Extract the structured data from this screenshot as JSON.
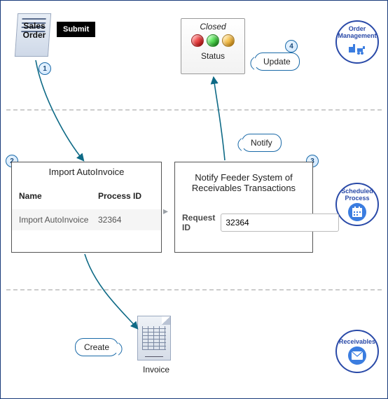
{
  "lanes": {
    "order_management": "Order Management",
    "scheduled_process": "Scheduled Process",
    "receivables": "Receivables"
  },
  "sales_order": {
    "label_line1": "Sales",
    "label_line2": "Order"
  },
  "submit": {
    "label": "Submit"
  },
  "status_panel": {
    "closed": "Closed",
    "label": "Status"
  },
  "steps": {
    "s1": "1",
    "s2": "2",
    "s3": "3",
    "s4": "4"
  },
  "callouts": {
    "update": "Update",
    "notify": "Notify",
    "create": "Create"
  },
  "proc_import": {
    "title": "Import AutoInvoice",
    "columns": {
      "name": "Name",
      "process_id": "Process ID"
    },
    "row": {
      "name": "Import AutoInvoice",
      "process_id": "32364"
    }
  },
  "proc_notify": {
    "title_line1": "Notify Feeder System of",
    "title_line2": "Receivables Transactions",
    "field_label": "Request ID",
    "field_value": "32364"
  },
  "invoice": {
    "label": "Invoice"
  }
}
